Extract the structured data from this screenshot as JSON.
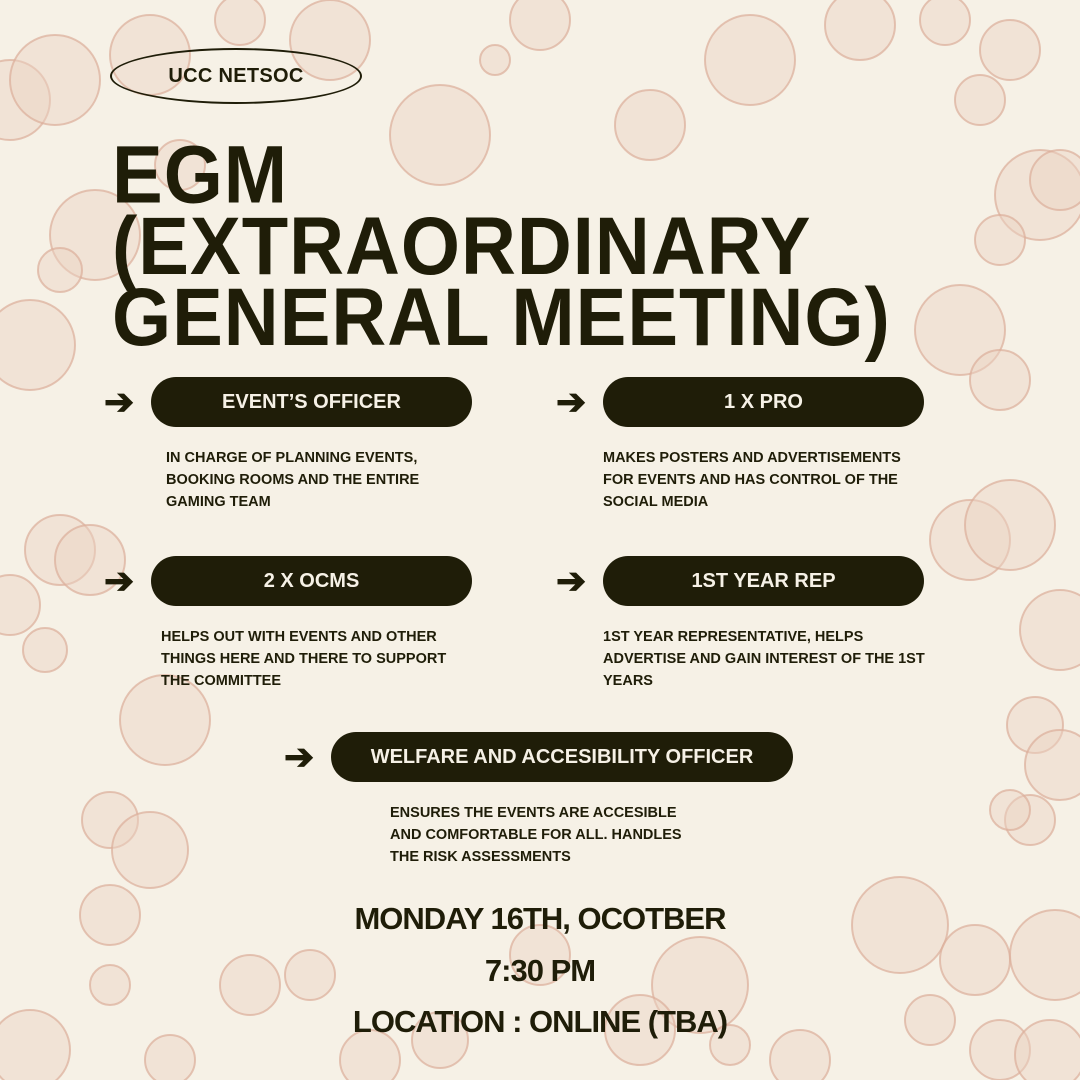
{
  "org": "UCC NETSOC",
  "title": [
    "EGM",
    "(EXTRAORDINARY",
    "GENERAL MEETING)"
  ],
  "roles": [
    {
      "label": "EVENT’S OFFICER",
      "description": "IN CHARGE OF PLANNING EVENTS, BOOKING ROOMS AND THE ENTIRE GAMING TEAM"
    },
    {
      "label": "1 X PRO",
      "description": "MAKES POSTERS AND ADVERTISEMENTS FOR EVENTS AND HAS CONTROL OF THE SOCIAL MEDIA"
    },
    {
      "label": "2 X OCMS",
      "description": "HELPS OUT WITH EVENTS AND OTHER THINGS HERE AND THERE TO SUPPORT THE COMMITTEE"
    },
    {
      "label": "1ST YEAR REP",
      "description": "1ST YEAR REPRESENTATIVE, HELPS ADVERTISE AND GAIN INTEREST OF THE 1ST YEARS"
    },
    {
      "label": "WELFARE AND ACCESIBILITY OFFICER",
      "description": "ENSURES THE EVENTS ARE ACCESIBLE AND COMFORTABLE FOR ALL. HANDLES THE RISK ASSESSMENTS"
    }
  ],
  "arrow_glyph": "➔",
  "date": "MONDAY 16TH, OCOTBER",
  "time": "7:30 PM",
  "location": "LOCATION : ONLINE (TBA)",
  "colors": {
    "background": "#f6f1e6",
    "ink": "#1f1d08",
    "bubble_fill": "#ecd3c4",
    "bubble_stroke": "#dcae9a"
  }
}
